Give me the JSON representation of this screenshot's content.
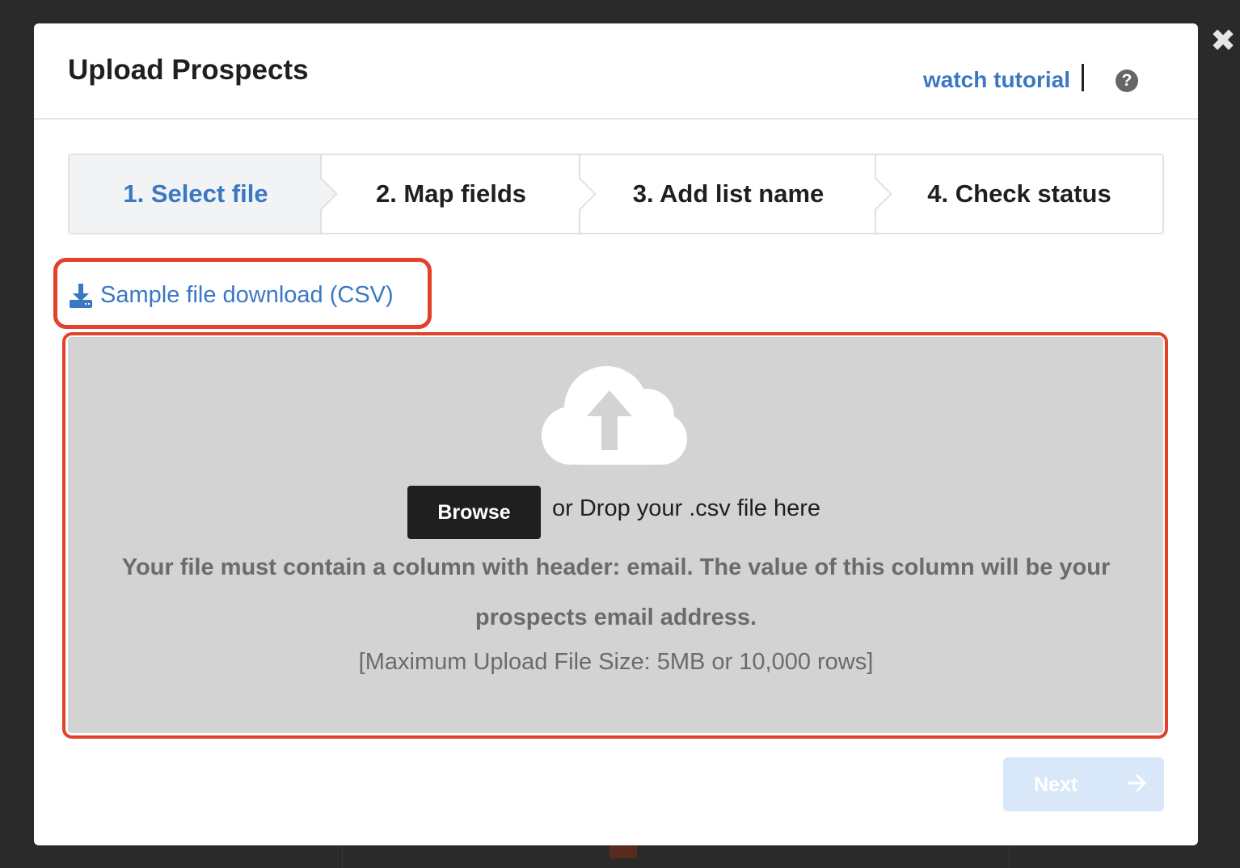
{
  "window": {
    "close_icon": "close-icon"
  },
  "modal": {
    "title": "Upload Prospects",
    "tutorial_link": "watch tutorial",
    "help_icon_glyph": "?"
  },
  "steps": [
    {
      "label": "1. Select file",
      "active": true
    },
    {
      "label": "2. Map fields",
      "active": false
    },
    {
      "label": "3. Add list name",
      "active": false
    },
    {
      "label": "4. Check status",
      "active": false
    }
  ],
  "sample": {
    "label": "Sample file download (CSV)",
    "icon": "download-icon"
  },
  "dropzone": {
    "icon": "cloud-upload-icon",
    "browse_label": "Browse",
    "drop_text": "or Drop your .csv file here",
    "requirement_text": "Your file must contain a column with header: email. The value of this column will be your prospects email address.",
    "limit_text": "[Maximum Upload File Size: 5MB or 10,000 rows]"
  },
  "footer": {
    "next_label": "Next",
    "next_icon": "arrow-right-icon"
  },
  "colors": {
    "accent": "#3a78c3",
    "highlight": "#e2412b",
    "dropzone_bg": "#d3d3d3",
    "next_disabled": "#d9e8f8"
  }
}
